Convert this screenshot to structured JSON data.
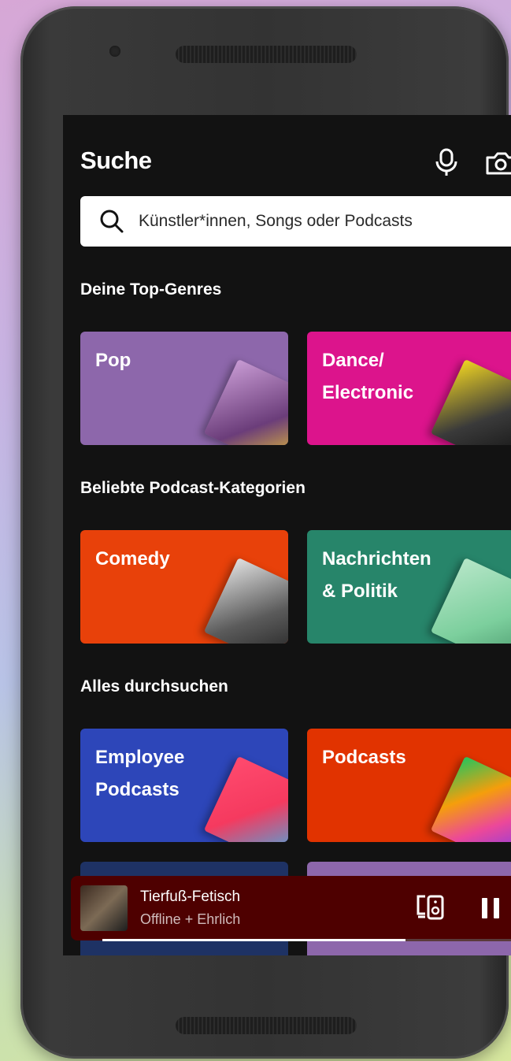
{
  "header": {
    "title": "Suche",
    "mic_icon": "microphone-icon",
    "camera_icon": "camera-icon"
  },
  "search": {
    "placeholder": "Künstler*innen, Songs oder Podcasts",
    "icon": "search-icon"
  },
  "sections": {
    "top_genres": {
      "heading": "Deine Top-Genres",
      "cards": [
        {
          "label": "Pop",
          "color": "#8d67ab"
        },
        {
          "label": "Dance/\nElectronic",
          "color": "#dc148c"
        }
      ]
    },
    "podcast_categories": {
      "heading": "Beliebte Podcast-Kategorien",
      "cards": [
        {
          "label": "Comedy",
          "color": "#e8410a"
        },
        {
          "label": "Nachrichten\n& Politik",
          "color": "#27856a"
        }
      ]
    },
    "browse_all": {
      "heading": "Alles durchsuchen",
      "cards": [
        {
          "label": "Employee\nPodcasts",
          "color": "#2d46b9"
        },
        {
          "label": "Podcasts",
          "color": "#e13300"
        }
      ]
    }
  },
  "now_playing": {
    "title": "Tierfuß-Fetisch",
    "subtitle": "Offline + Ehrlich",
    "progress": 0.74,
    "background": "#4e0000"
  }
}
